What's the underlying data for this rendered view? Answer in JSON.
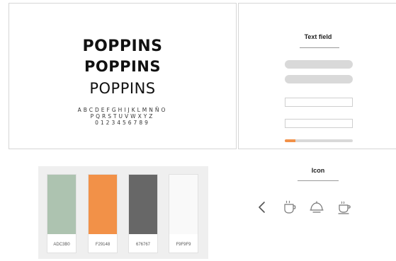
{
  "typography": {
    "font_name_black": "POPPINS",
    "font_name_bold": "POPPINS",
    "font_name_regular": "POPPINS",
    "glyph_line_1": "ABCDEFGHIJKLMNÑO",
    "glyph_line_2": "PQRSTUVWXYZ",
    "glyph_line_3": "0123456789"
  },
  "text_field_panel": {
    "title": "Text field",
    "progress_fraction": 0.16,
    "progress_color": "#f29148"
  },
  "palette": {
    "colors": [
      {
        "label": "ADC3B0",
        "hex": "#ADC3B0"
      },
      {
        "label": "F29148",
        "hex": "#F29148"
      },
      {
        "label": "676767",
        "hex": "#676767"
      },
      {
        "label": "F9F9F9",
        "hex": "#F9F9F9"
      }
    ]
  },
  "icons_panel": {
    "title": "Icon",
    "icons": [
      "chevron-left-icon",
      "coffee-cup-icon",
      "food-cloche-icon",
      "tea-cup-icon"
    ]
  }
}
